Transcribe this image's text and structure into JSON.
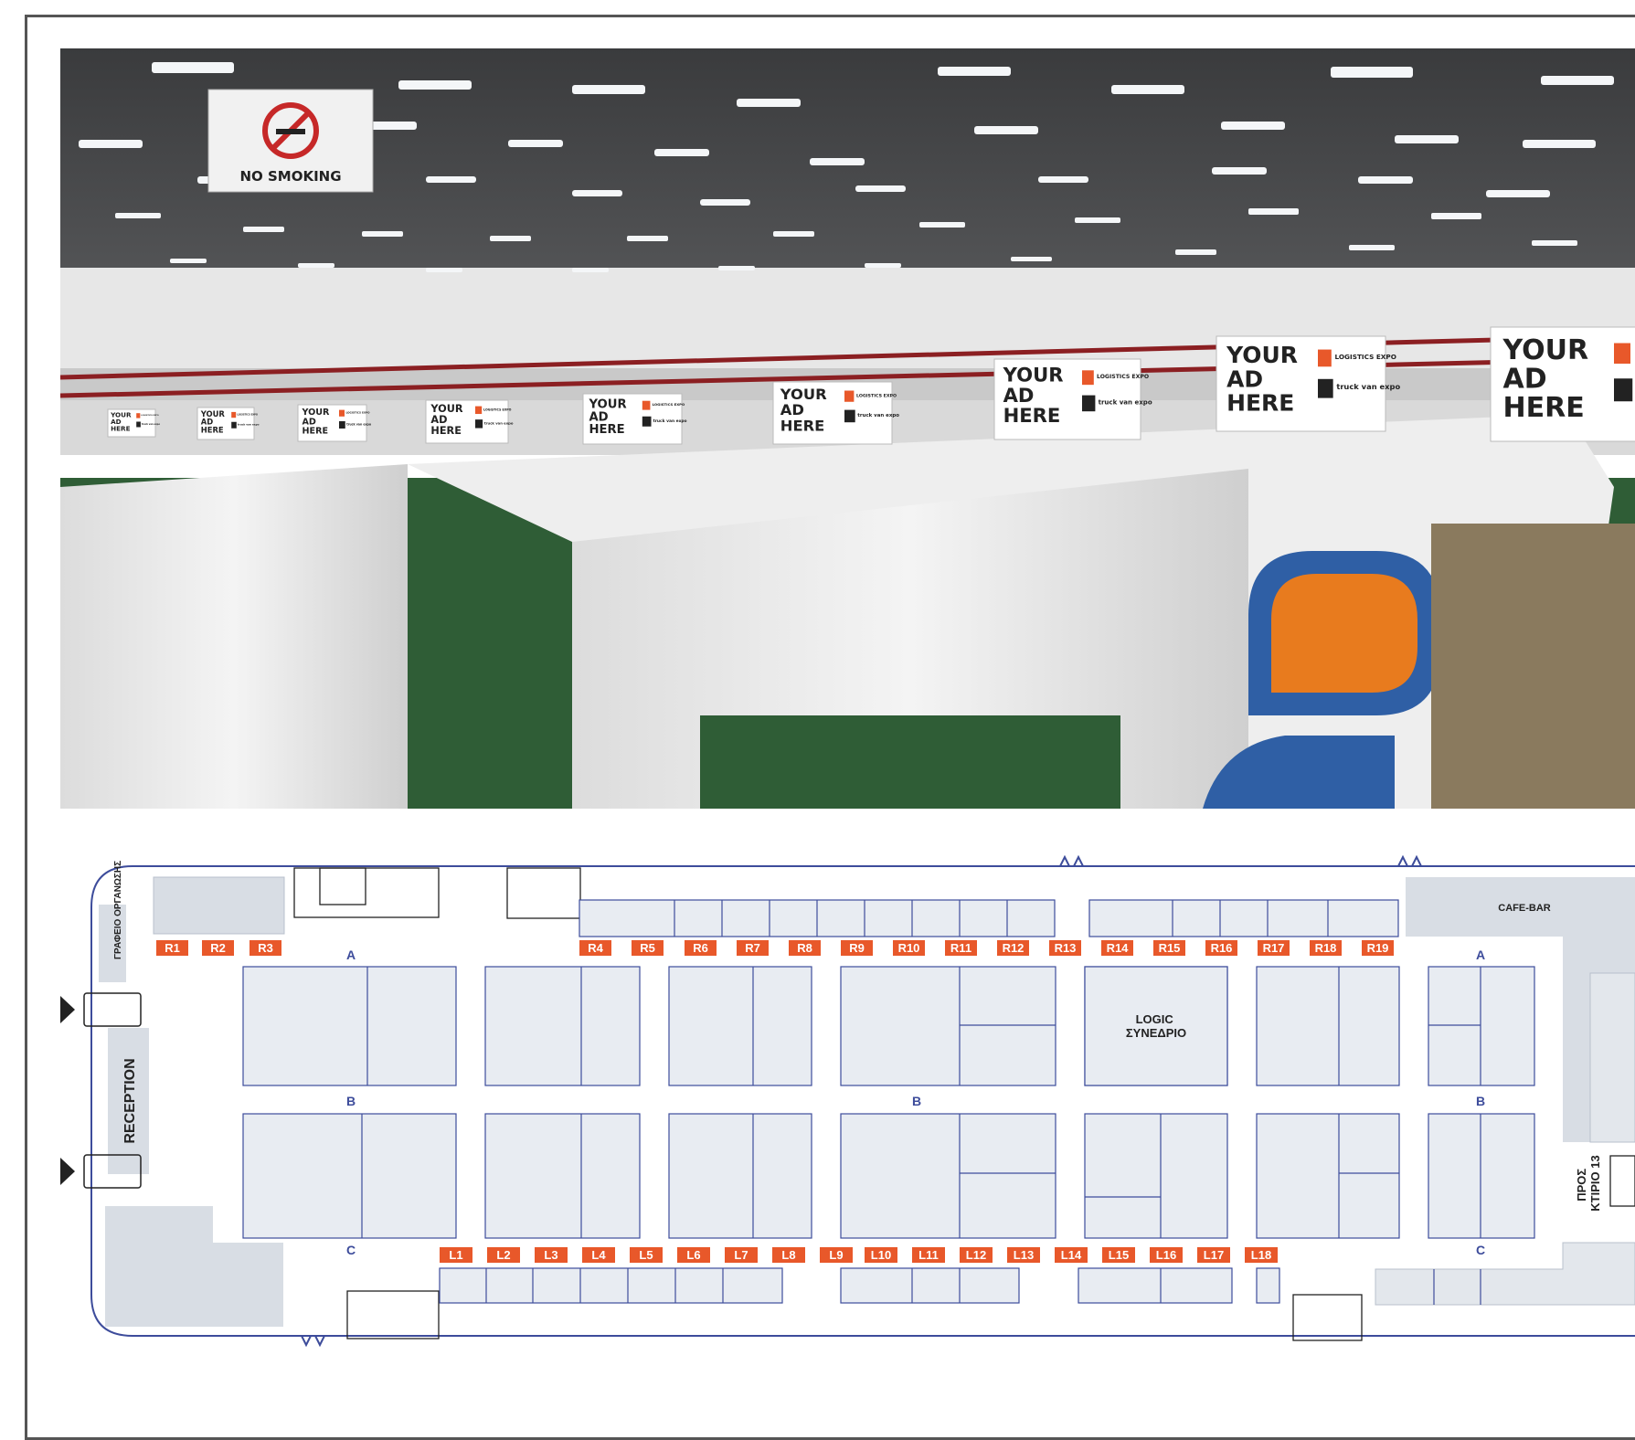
{
  "photo": {
    "sign_text": "NO SMOKING",
    "banners": [
      {
        "text": "YOUR AD HERE",
        "logo1": "LOGISTICS EXPO",
        "logo2": "truck van expo"
      },
      {
        "text": "YOUR AD HERE",
        "logo1": "LOGISTICS EXPO",
        "logo2": "truck van expo"
      },
      {
        "text": "YOUR AD HERE",
        "logo1": "LOGISTICS EXPO",
        "logo2": "truck van expo"
      },
      {
        "text": "YOUR AD HERE",
        "logo1": "LOGISTICS EXPO",
        "logo2": "truck van expo"
      },
      {
        "text": "YOUR AD HERE",
        "logo1": "LOGISTICS EXPO",
        "logo2": "truck van expo"
      },
      {
        "text": "YOUR AD HERE",
        "logo1": "LOGISTICS EXPO",
        "logo2": "truck van expo"
      },
      {
        "text": "YOUR AD HERE",
        "logo1": "LOGISTICS EXPO",
        "logo2": "truck van expo"
      },
      {
        "text": "YOUR AD HERE",
        "logo1": "LOGISTICS EXPO",
        "logo2": "truck van expo"
      },
      {
        "text": "YOUR AD HERE",
        "logo1": "LOGISTICS EXPO",
        "logo2": "truck van expo"
      }
    ]
  },
  "floorplan": {
    "office_label": "ΓΡΑΦΕΙΟ ΟΡΓΑΝΩΣΗΣ",
    "reception_label": "RECEPTION",
    "cafe_label": "CAFE-BAR",
    "conference_label_1": "LOGIC",
    "conference_label_2": "ΣΥΝΕΔΡΙΟ",
    "exit_label_1": "ΠΡΟΣ",
    "exit_label_2": "ΚΤΙΡΙΟ 13",
    "aisle_labels": [
      "A",
      "B",
      "C",
      "A",
      "B",
      "C",
      "B"
    ],
    "r_positions": [
      "R1",
      "R2",
      "R3",
      "R4",
      "R5",
      "R6",
      "R7",
      "R8",
      "R9",
      "R10",
      "R11",
      "R12",
      "R13",
      "R14",
      "R15",
      "R16",
      "R17",
      "R18",
      "R19"
    ],
    "l_positions": [
      "L1",
      "L2",
      "L3",
      "L4",
      "L5",
      "L6",
      "L7",
      "L8",
      "L9",
      "L10",
      "L11",
      "L12",
      "L13",
      "L14",
      "L15",
      "L16",
      "L17",
      "L18"
    ],
    "colors": {
      "tag": "#e8582a",
      "booth_fill": "#e8ecf2",
      "booth_line": "#3d4c9b",
      "area_fill": "#d8dde4",
      "aisle_text": "#3d4c9b"
    }
  }
}
